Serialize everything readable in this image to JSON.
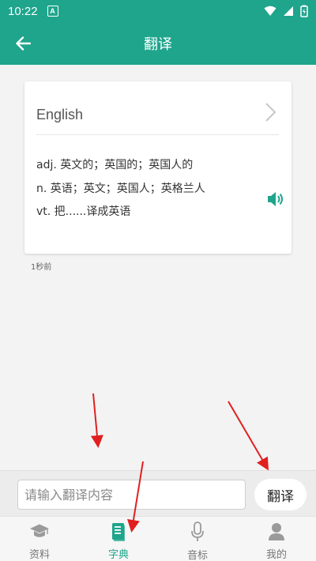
{
  "status_bar": {
    "time": "10:22",
    "notification_letter": "A"
  },
  "app_bar": {
    "title": "翻译"
  },
  "result_card": {
    "language": "English",
    "definitions": [
      "adj. 英文的；英国的；英国人的",
      "n. 英语；英文；英国人；英格兰人",
      "vt. 把......译成英语"
    ]
  },
  "time_ago": "1秒前",
  "input_bar": {
    "placeholder": "请输入翻译内容",
    "value": "",
    "translate_label": "翻译"
  },
  "bottom_nav": {
    "items": [
      {
        "label": "资料",
        "icon": "graduation-cap-icon",
        "active": false
      },
      {
        "label": "字典",
        "icon": "book-icon",
        "active": true
      },
      {
        "label": "音标",
        "icon": "microphone-icon",
        "active": false
      },
      {
        "label": "我的",
        "icon": "person-icon",
        "active": false
      }
    ]
  },
  "colors": {
    "primary": "#1ea58c",
    "annotation_arrow": "#e02020"
  }
}
